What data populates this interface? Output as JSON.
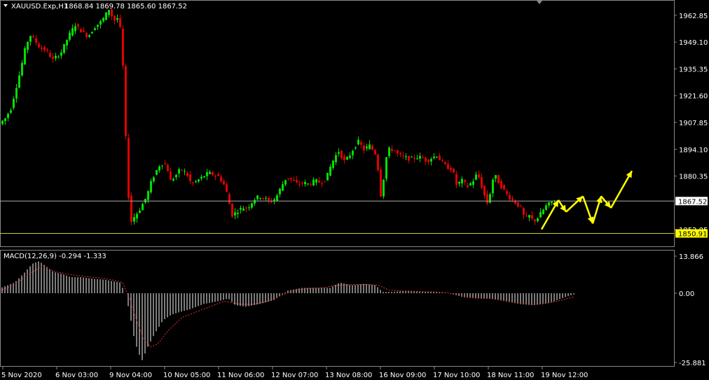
{
  "header": {
    "symbol": "XAUUSD.Exp,H1",
    "ohlc": "1868.84 1869.78 1865.60 1867.52"
  },
  "colors": {
    "background": "#000000",
    "bull_candle": "#00e000",
    "bear_candle": "#e00000",
    "price_line": "#aaaaaa",
    "support_line": "#c8c832",
    "macd_hist": "#c0c0c0",
    "macd_signal": "#e03030",
    "arrow": "#ffff00",
    "axis_text": "#ffffff"
  },
  "chart_data": [
    {
      "type": "candlestick",
      "ylim": [
        1845,
        1970
      ],
      "y_ticks": [
        "1962.85",
        "1949.10",
        "1935.35",
        "1921.60",
        "1907.85",
        "1894.10",
        "1880.35",
        "1852.85"
      ],
      "current_price": {
        "label": "1867.52",
        "value": 1867.52
      },
      "support_level": {
        "label": "1850.91",
        "value": 1850.91
      },
      "x_ticks": [
        "5 Nov 2020",
        "6 Nov 03:00",
        "9 Nov 04:00",
        "10 Nov 05:00",
        "11 Nov 06:00",
        "12 Nov 07:00",
        "13 Nov 08:00",
        "16 Nov 09:00",
        "17 Nov 10:00",
        "18 Nov 11:00",
        "19 Nov 12:00"
      ],
      "price_path": [
        [
          0,
          1906
        ],
        [
          4,
          1908
        ],
        [
          10,
          1910
        ],
        [
          18,
          1915
        ],
        [
          25,
          1925
        ],
        [
          32,
          1935
        ],
        [
          38,
          1945
        ],
        [
          45,
          1953
        ],
        [
          52,
          1950
        ],
        [
          60,
          1946
        ],
        [
          68,
          1945
        ],
        [
          78,
          1940
        ],
        [
          90,
          1944
        ],
        [
          100,
          1952
        ],
        [
          110,
          1958
        ],
        [
          118,
          1955
        ],
        [
          128,
          1952
        ],
        [
          138,
          1957
        ],
        [
          148,
          1960
        ],
        [
          158,
          1966
        ],
        [
          165,
          1960
        ],
        [
          172,
          1962
        ],
        [
          176,
          1950
        ],
        [
          179,
          1930
        ],
        [
          182,
          1900
        ],
        [
          186,
          1870
        ],
        [
          190,
          1857
        ],
        [
          195,
          1860
        ],
        [
          200,
          1862
        ],
        [
          206,
          1866
        ],
        [
          212,
          1870
        ],
        [
          218,
          1877
        ],
        [
          224,
          1882
        ],
        [
          232,
          1887
        ],
        [
          240,
          1886
        ],
        [
          246,
          1878
        ],
        [
          252,
          1880
        ],
        [
          260,
          1884
        ],
        [
          268,
          1882
        ],
        [
          276,
          1876
        ],
        [
          284,
          1878
        ],
        [
          292,
          1880
        ],
        [
          300,
          1882
        ],
        [
          308,
          1881
        ],
        [
          315,
          1880
        ],
        [
          322,
          1876
        ],
        [
          328,
          1870
        ],
        [
          333,
          1860
        ],
        [
          340,
          1862
        ],
        [
          348,
          1864
        ],
        [
          356,
          1864
        ],
        [
          364,
          1868
        ],
        [
          372,
          1870
        ],
        [
          380,
          1869
        ],
        [
          388,
          1867
        ],
        [
          396,
          1869
        ],
        [
          404,
          1875
        ],
        [
          412,
          1880
        ],
        [
          420,
          1878
        ],
        [
          428,
          1876
        ],
        [
          436,
          1877
        ],
        [
          444,
          1876
        ],
        [
          452,
          1878
        ],
        [
          460,
          1877
        ],
        [
          468,
          1879
        ],
        [
          474,
          1885
        ],
        [
          480,
          1890
        ],
        [
          486,
          1893
        ],
        [
          494,
          1888
        ],
        [
          500,
          1890
        ],
        [
          508,
          1895
        ],
        [
          514,
          1898
        ],
        [
          522,
          1894
        ],
        [
          530,
          1896
        ],
        [
          538,
          1892
        ],
        [
          544,
          1880
        ],
        [
          547,
          1866
        ],
        [
          552,
          1888
        ],
        [
          558,
          1894
        ],
        [
          564,
          1894
        ],
        [
          572,
          1891
        ],
        [
          580,
          1890
        ],
        [
          588,
          1889
        ],
        [
          596,
          1890
        ],
        [
          604,
          1890
        ],
        [
          612,
          1888
        ],
        [
          620,
          1890
        ],
        [
          626,
          1891
        ],
        [
          632,
          1888
        ],
        [
          640,
          1885
        ],
        [
          648,
          1884
        ],
        [
          654,
          1876
        ],
        [
          662,
          1878
        ],
        [
          670,
          1875
        ],
        [
          678,
          1878
        ],
        [
          684,
          1882
        ],
        [
          690,
          1875
        ],
        [
          696,
          1868
        ],
        [
          700,
          1865
        ],
        [
          704,
          1878
        ],
        [
          710,
          1880
        ],
        [
          716,
          1876
        ],
        [
          722,
          1873
        ],
        [
          728,
          1870
        ],
        [
          734,
          1868
        ],
        [
          740,
          1866
        ],
        [
          746,
          1864
        ],
        [
          752,
          1858
        ],
        [
          758,
          1860
        ],
        [
          764,
          1857
        ],
        [
          770,
          1859
        ],
        [
          776,
          1862
        ],
        [
          782,
          1865
        ],
        [
          790,
          1867
        ]
      ],
      "projection_arrows": [
        {
          "from": [
            773,
            1853
          ],
          "to": [
            797,
            1868
          ]
        },
        {
          "from": [
            797,
            1868
          ],
          "to": [
            808,
            1862
          ]
        },
        {
          "from": [
            808,
            1862
          ],
          "to": [
            832,
            1870
          ]
        },
        {
          "from": [
            832,
            1870
          ],
          "to": [
            846,
            1856
          ]
        },
        {
          "from": [
            846,
            1856
          ],
          "to": [
            858,
            1870
          ]
        },
        {
          "from": [
            858,
            1870
          ],
          "to": [
            872,
            1864
          ]
        },
        {
          "from": [
            872,
            1864
          ],
          "to": [
            902,
            1883
          ]
        }
      ]
    },
    {
      "type": "histogram",
      "title": "MACD(12,26,9) -0.294 -1.333",
      "ylim": [
        -25.881,
        13.866
      ],
      "y_ticks": [
        "13.866",
        "0.00",
        "-25.881"
      ],
      "macd_path": [
        [
          0,
          2
        ],
        [
          20,
          4
        ],
        [
          35,
          8
        ],
        [
          45,
          11
        ],
        [
          55,
          12
        ],
        [
          65,
          10
        ],
        [
          75,
          8
        ],
        [
          90,
          7
        ],
        [
          100,
          6
        ],
        [
          115,
          6
        ],
        [
          130,
          5.5
        ],
        [
          150,
          5
        ],
        [
          170,
          4
        ],
        [
          178,
          0
        ],
        [
          183,
          -6
        ],
        [
          190,
          -16
        ],
        [
          196,
          -22
        ],
        [
          202,
          -25
        ],
        [
          210,
          -20
        ],
        [
          220,
          -15
        ],
        [
          232,
          -10
        ],
        [
          244,
          -8
        ],
        [
          256,
          -7
        ],
        [
          270,
          -6
        ],
        [
          290,
          -4
        ],
        [
          310,
          -3
        ],
        [
          325,
          -2
        ],
        [
          335,
          -4.5
        ],
        [
          350,
          -5
        ],
        [
          370,
          -4
        ],
        [
          390,
          -2.5
        ],
        [
          410,
          1
        ],
        [
          430,
          2
        ],
        [
          450,
          2
        ],
        [
          470,
          2
        ],
        [
          484,
          4
        ],
        [
          500,
          3
        ],
        [
          520,
          3.5
        ],
        [
          535,
          3
        ],
        [
          545,
          0.5
        ],
        [
          560,
          0.5
        ],
        [
          580,
          1
        ],
        [
          600,
          0.5
        ],
        [
          620,
          0.5
        ],
        [
          640,
          0
        ],
        [
          660,
          -1.5
        ],
        [
          680,
          -2
        ],
        [
          700,
          -2
        ],
        [
          720,
          -3
        ],
        [
          740,
          -4
        ],
        [
          760,
          -4.5
        ],
        [
          775,
          -4
        ],
        [
          790,
          -3
        ],
        [
          805,
          -1.5
        ],
        [
          820,
          -0.3
        ]
      ],
      "signal_path": [
        [
          0,
          1
        ],
        [
          20,
          3
        ],
        [
          40,
          7
        ],
        [
          60,
          10
        ],
        [
          80,
          8
        ],
        [
          100,
          7
        ],
        [
          120,
          6.3
        ],
        [
          140,
          5.8
        ],
        [
          160,
          5
        ],
        [
          175,
          4
        ],
        [
          185,
          -2
        ],
        [
          195,
          -10
        ],
        [
          205,
          -17
        ],
        [
          215,
          -20
        ],
        [
          225,
          -19
        ],
        [
          240,
          -14
        ],
        [
          260,
          -9
        ],
        [
          280,
          -7
        ],
        [
          300,
          -5
        ],
        [
          320,
          -3
        ],
        [
          340,
          -4
        ],
        [
          360,
          -4.2
        ],
        [
          380,
          -3.2
        ],
        [
          400,
          -1
        ],
        [
          420,
          1
        ],
        [
          440,
          1.8
        ],
        [
          460,
          2
        ],
        [
          480,
          3
        ],
        [
          500,
          3.2
        ],
        [
          520,
          3.3
        ],
        [
          540,
          3
        ],
        [
          555,
          1.2
        ],
        [
          575,
          0.8
        ],
        [
          600,
          0.7
        ],
        [
          620,
          0.5
        ],
        [
          640,
          0.1
        ],
        [
          660,
          -1
        ],
        [
          680,
          -1.8
        ],
        [
          700,
          -2
        ],
        [
          720,
          -2.7
        ],
        [
          740,
          -3.5
        ],
        [
          760,
          -4.1
        ],
        [
          780,
          -3.8
        ],
        [
          800,
          -2.7
        ],
        [
          820,
          -1.3
        ]
      ]
    }
  ]
}
